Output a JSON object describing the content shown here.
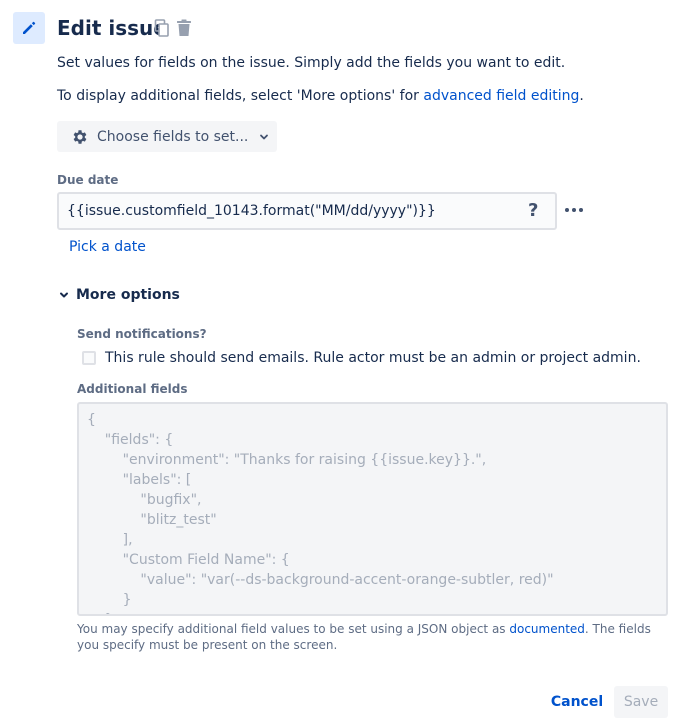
{
  "header": {
    "title": "Edit issue",
    "icon": "pencil-icon",
    "actions": [
      "copy-icon",
      "trash-icon"
    ]
  },
  "description": {
    "line1": "Set values for fields on the issue. Simply add the fields you want to edit.",
    "line2_prefix": "To display additional fields, select 'More options' for ",
    "line2_link": "advanced field editing",
    "line2_suffix": "."
  },
  "choose_fields": {
    "label": "Choose fields to set...",
    "icon": "gear-icon"
  },
  "due_date": {
    "label": "Due date",
    "value": "{{issue.customfield_10143.format(\"MM/dd/yyyy\")}}",
    "help": "?",
    "pick_date": "Pick a date"
  },
  "more_options": {
    "label": "More options",
    "send_notifications_label": "Send notifications?",
    "checkbox_label": "This rule should send emails. Rule actor must be an admin or project admin.",
    "checkbox_checked": false,
    "additional_fields_label": "Additional fields",
    "json_placeholder": "{\n    \"fields\": {\n        \"environment\": \"Thanks for raising {{issue.key}}.\",\n        \"labels\": [\n            \"bugfix\",\n            \"blitz_test\"\n        ],\n        \"Custom Field Name\": {\n            \"value\": \"var(--ds-background-accent-orange-subtler, red)\"\n        }\n    }\n}",
    "help_prefix": "You may specify additional field values to be set using a JSON object as ",
    "help_link": "documented",
    "help_suffix": ". The fields you specify must be present on the screen."
  },
  "footer": {
    "cancel": "Cancel",
    "save": "Save"
  },
  "colors": {
    "primary": "#0052cc",
    "text": "#172b4d",
    "subtle": "#5e6c84",
    "disabled": "#a5adba",
    "icon_bg": "#deebff"
  }
}
